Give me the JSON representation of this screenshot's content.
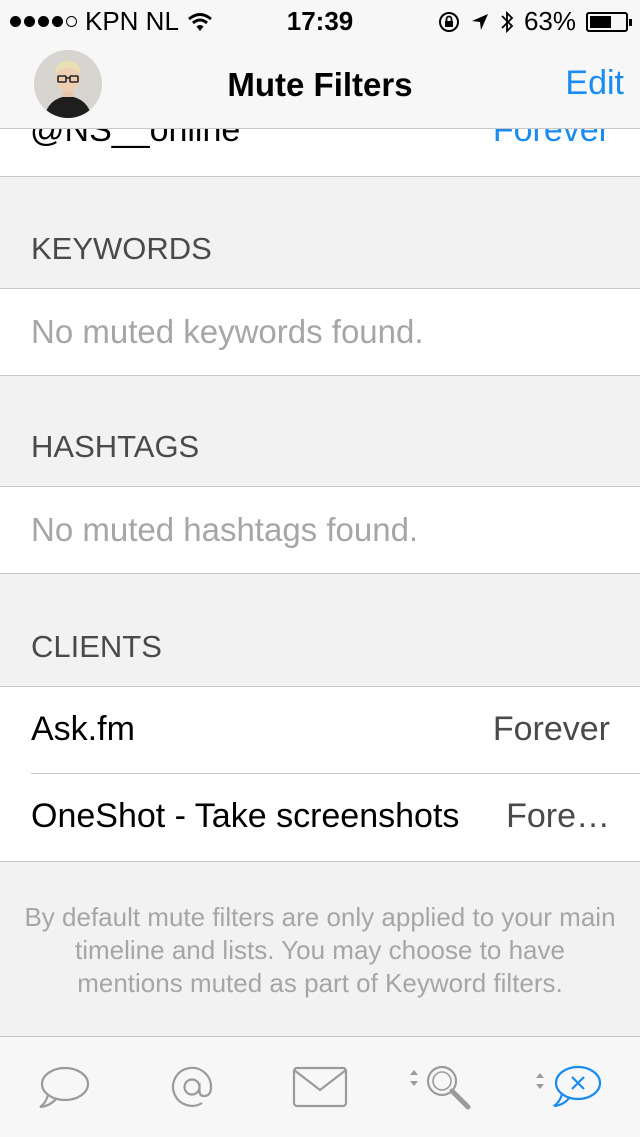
{
  "status_bar": {
    "carrier": "KPN NL",
    "time": "17:39",
    "battery_percent": "63%",
    "battery_level": 0.63
  },
  "nav": {
    "title": "Mute Filters",
    "edit_label": "Edit"
  },
  "partial_row": {
    "name": "@NS__online",
    "value": "Forever"
  },
  "sections": {
    "keywords": {
      "header": "KEYWORDS",
      "empty": "No muted keywords found."
    },
    "hashtags": {
      "header": "HASHTAGS",
      "empty": "No muted hashtags found."
    },
    "clients": {
      "header": "CLIENTS",
      "items": [
        {
          "name": "Ask.fm",
          "value": "Forever"
        },
        {
          "name": "OneShot - Take screenshots",
          "value": "Fore…"
        }
      ]
    }
  },
  "footer_note": "By default mute filters are only applied to your main timeline and lists. You may choose to have mentions muted as part of Keyword filters.",
  "tabs": [
    {
      "icon": "timeline-bubble-icon",
      "active": false
    },
    {
      "icon": "mentions-at-icon",
      "active": false
    },
    {
      "icon": "messages-envelope-icon",
      "active": false
    },
    {
      "icon": "search-magnifier-icon",
      "active": false
    },
    {
      "icon": "mute-filters-icon",
      "active": true
    }
  ],
  "colors": {
    "accent": "#1a8cf0",
    "inactive_icon": "#9b9b9b",
    "background": "#f2f2f2"
  }
}
